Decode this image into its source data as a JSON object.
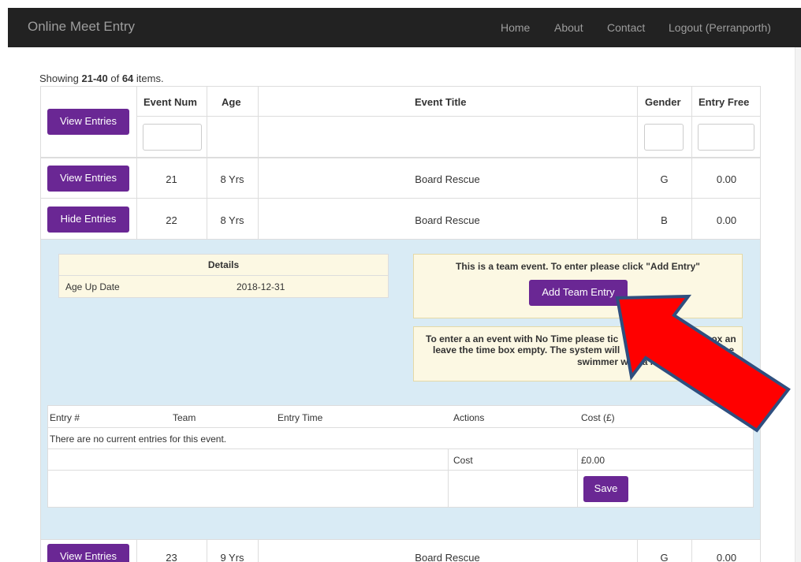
{
  "app": {
    "brand": "Online Meet Entry",
    "nav": [
      "Home",
      "About",
      "Contact",
      "Logout (Perranporth)"
    ]
  },
  "summary": {
    "prefix": "Showing ",
    "range": "21-40",
    "of": " of ",
    "total": "64",
    "suffix": " items."
  },
  "table": {
    "headers": [
      "Event Num",
      "Age",
      "Event Title",
      "Gender",
      "Entry Free"
    ],
    "header_button": "View Entries",
    "rows": [
      {
        "button": "View Entries",
        "event_num": "21",
        "age": "8 Yrs",
        "title": "Board Rescue",
        "gender": "G",
        "fee": "0.00"
      },
      {
        "button": "Hide Entries",
        "event_num": "22",
        "age": "8 Yrs",
        "title": "Board Rescue",
        "gender": "B",
        "fee": "0.00"
      },
      {
        "button": "View Entries",
        "event_num": "23",
        "age": "9 Yrs",
        "title": "Board Rescue",
        "gender": "G",
        "fee": "0.00"
      }
    ]
  },
  "details": {
    "header": "Details",
    "label": "Age Up Date",
    "value": "2018-12-31"
  },
  "team": {
    "notice": "This is a team event. To enter please click \"Add Entry\"",
    "button": "Add Team Entry",
    "nt_line1": "To enter a an event with No Time please tic",
    "nt_line1_right": "box an",
    "nt_line2": "leave the time box empty. The system will",
    "nt_line2_right": "he",
    "nt_line3": "swimmer with a NT"
  },
  "entries": {
    "headers": [
      "Entry #",
      "Team",
      "Entry Time",
      "Actions",
      "Cost (£)"
    ],
    "empty_message": "There are no current entries for this event.",
    "cost_label": "Cost",
    "cost_value": "£0.00",
    "save_button": "Save"
  },
  "colors": {
    "navbar": "#222222",
    "button": "#6a2794",
    "detail_bg": "#d9ebf5",
    "notice_bg": "#fcf8e3",
    "arrow_fill": "#ff0000",
    "arrow_stroke": "#2f4f7f"
  }
}
